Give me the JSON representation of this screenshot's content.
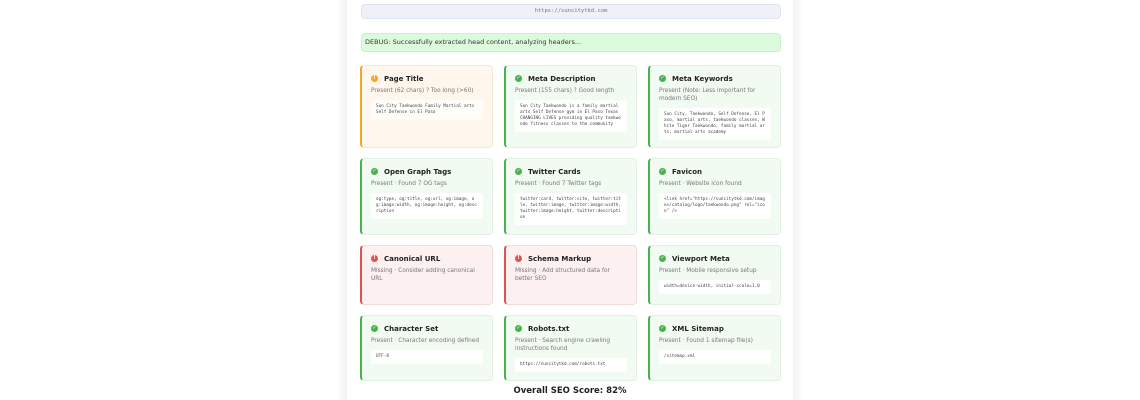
{
  "url": "https://suncitytkd.com",
  "debug": "DEBUG: Successfully extracted head content, analyzing headers...",
  "cards": [
    {
      "title": "Page Title",
      "status": "Present (62 chars) ? Too long (>60)",
      "code": "Sun City Taekwondo Family Martial arts Self Defense in El Paso",
      "state": "warn",
      "icon": "!"
    },
    {
      "title": "Meta Description",
      "status": "Present (155 chars) ? Good length",
      "code": "Sun City Taekwondo is a family martial arts Self Defense gym in El Paso Texas CHANGING LIVES providing quality taekwondo fitness classes to the community",
      "state": "ok",
      "icon": "✓"
    },
    {
      "title": "Meta Keywords",
      "status": "Present (Note: Less important for modern SEO)",
      "code": "Sun City, Taekwondo, Self Defense, El Paso, martial arts, taekwondo classes, White Tiger Taekwondo, family martial arts, martial arts academy",
      "state": "ok",
      "icon": "✓"
    },
    {
      "title": "Open Graph Tags",
      "status": "Present · Found 7 OG tags",
      "code": "og:type, og:title, og:url, og:image, og:image:width, og:image:height, og:description",
      "state": "ok",
      "icon": "✓"
    },
    {
      "title": "Twitter Cards",
      "status": "Present · Found 7 Twitter tags",
      "code": "twitter:card, twitter:site, twitter:title, twitter:image, twitter:image:width, twitter:image:height, twitter:description",
      "state": "ok",
      "icon": "✓"
    },
    {
      "title": "Favicon",
      "status": "Present · Website icon found",
      "code": "<link href=\"https://suncitytkd.com/images/catalog/logo/taekwondo.png\" rel=\"icon\" />",
      "state": "ok",
      "icon": "✓"
    },
    {
      "title": "Canonical URL",
      "status": "Missing · Consider adding canonical URL",
      "code": "",
      "state": "err",
      "icon": "!"
    },
    {
      "title": "Schema Markup",
      "status": "Missing · Add structured data for better SEO",
      "code": "",
      "state": "err",
      "icon": "!"
    },
    {
      "title": "Viewport Meta",
      "status": "Present · Mobile responsive setup",
      "code": "width=device-width, initial-scale=1.0",
      "state": "ok",
      "icon": "✓"
    },
    {
      "title": "Character Set",
      "status": "Present · Character encoding defined",
      "code": "UTF-8",
      "state": "ok",
      "icon": "✓"
    },
    {
      "title": "Robots.txt",
      "status": "Present · Search engine crawling instructions found",
      "code": "https://suncitytkd.com/robots.txt",
      "state": "ok",
      "icon": "✓"
    },
    {
      "title": "XML Sitemap",
      "status": "Present · Found 1 sitemap file(s)",
      "code": "/sitemap.xml",
      "state": "ok",
      "icon": "✓"
    }
  ],
  "score": "Overall SEO Score: 82%",
  "colors": {
    "ok": "#4caf50",
    "warn": "#f5a623",
    "err": "#e05252"
  }
}
